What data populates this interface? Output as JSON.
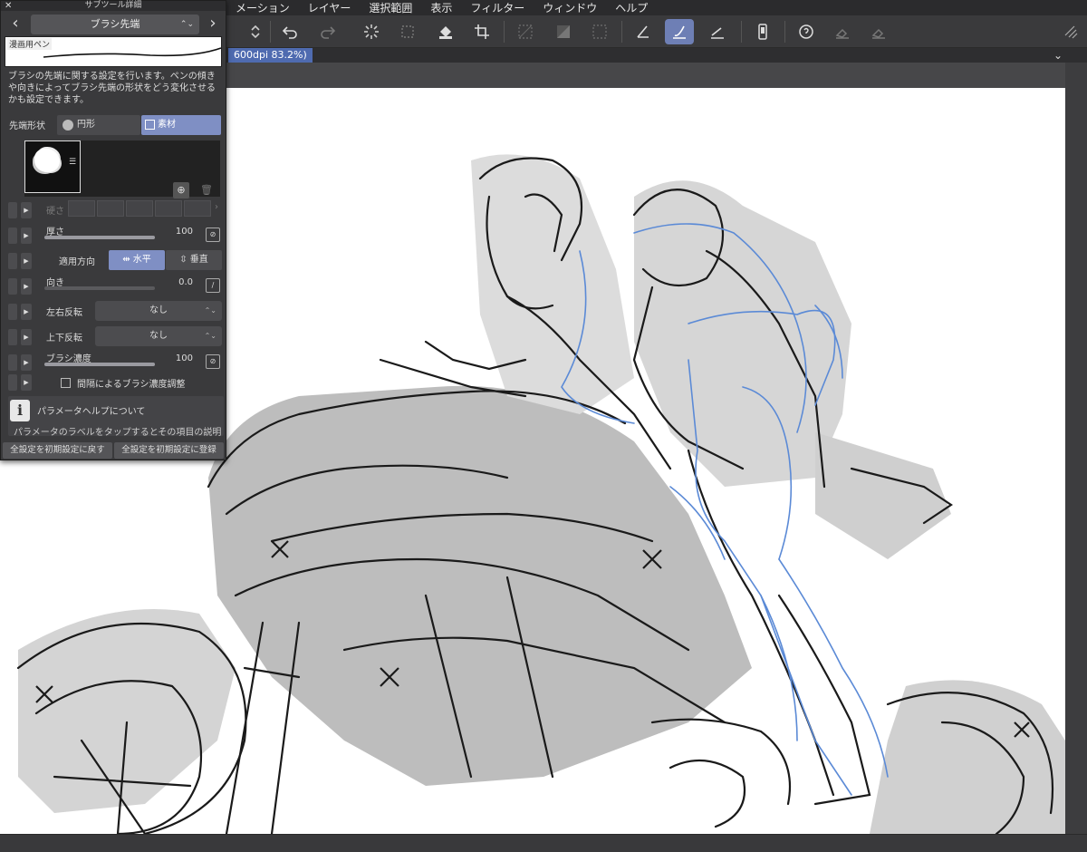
{
  "menubar": {
    "items": [
      "メーション",
      "レイヤー",
      "選択範囲",
      "表示",
      "フィルター",
      "ウィンドウ",
      "ヘルプ"
    ]
  },
  "toolbar": {
    "icons": [
      "undo-icon",
      "redo-icon",
      "loading-icon",
      "transform-icon",
      "fill-icon",
      "crop-icon",
      "selection-icon",
      "hatch-icon",
      "grid-icon",
      "pen-icon",
      "brush-icon",
      "ruler-icon",
      "device-icon",
      "help-icon",
      "eraser-icon",
      "eraser2-icon"
    ],
    "active": "brush-icon"
  },
  "document_tab": {
    "label": "600dpi 83.2%)"
  },
  "subtool": {
    "window_title": "サブツール詳細",
    "category": "ブラシ先端",
    "preset_name": "漫画用ペン",
    "description": "ブラシの先端に関する設定を行います。ペンの傾きや向きによってブラシ先端の形状をどう変化させるかも設定できます。",
    "shape": {
      "label": "先端形状",
      "circle": "円形",
      "material": "素材",
      "selected": "素材"
    },
    "params": {
      "hardness": {
        "label": "硬さ"
      },
      "thickness": {
        "label": "厚さ",
        "value": "100"
      },
      "apply_direction": {
        "label": "適用方向",
        "horizontal": "水平",
        "vertical": "垂直",
        "selected": "水平"
      },
      "direction": {
        "label": "向き",
        "value": "0.0"
      },
      "flip_h": {
        "label": "左右反転",
        "value": "なし"
      },
      "flip_v": {
        "label": "上下反転",
        "value": "なし"
      },
      "density": {
        "label": "ブラシ濃度",
        "value": "100"
      },
      "interval_density": {
        "label": "間隔によるブラシ濃度調整",
        "checked": false
      }
    },
    "help": {
      "title": "パラメータヘルプについて",
      "text": "パラメータのラベルをタップするとその項目の説明"
    },
    "footer": {
      "reset": "全設定を初期設定に戻す",
      "register": "全設定を初期設定に登録"
    }
  },
  "colors": {
    "accent": "#7f8fc4",
    "tab": "#4f6bb0",
    "panel": "#3a3a3c",
    "sketch_blue": "#5b8ad6"
  }
}
